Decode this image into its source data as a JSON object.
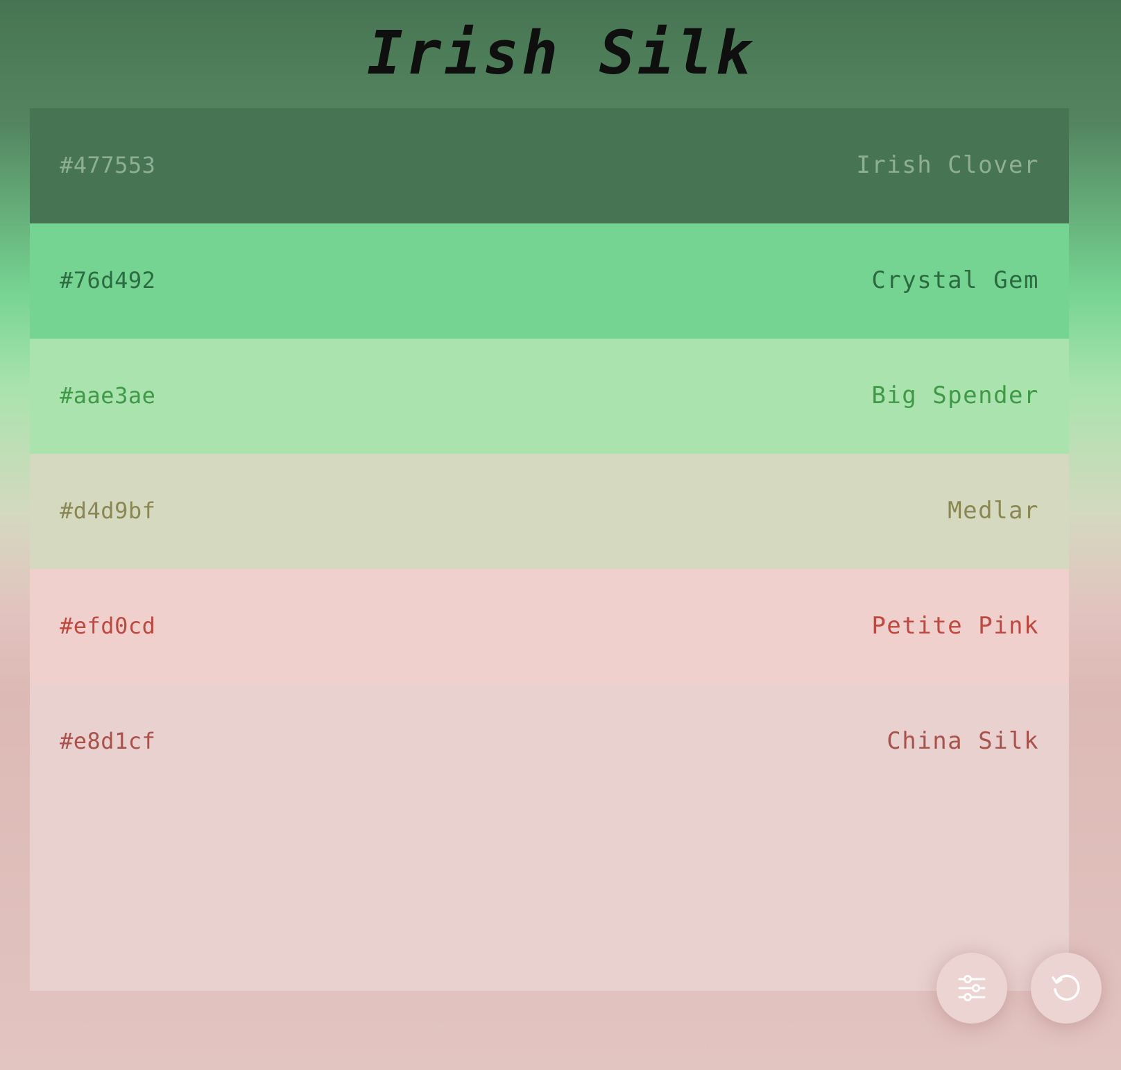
{
  "title": "Irish Silk",
  "swatches": [
    {
      "hex": "#477553",
      "name": "Irish Clover",
      "bg": "#477553",
      "text_color": "#8fae96"
    },
    {
      "hex": "#76d492",
      "name": "Crystal Gem",
      "bg": "#76d492",
      "text_color": "#2c6b41"
    },
    {
      "hex": "#aae3ae",
      "name": "Big Spender",
      "bg": "#aae3ae",
      "text_color": "#3e9a46"
    },
    {
      "hex": "#d4d9bf",
      "name": "Medlar",
      "bg": "#d4d9bf",
      "text_color": "#8a8752"
    },
    {
      "hex": "#efd0cd",
      "name": "Petite Pink",
      "bg": "#efd0cd",
      "text_color": "#c0483f"
    },
    {
      "hex": "#e8d1cf",
      "name": "China Silk",
      "bg": "#e8d1cf",
      "text_color": "#a9514a"
    }
  ],
  "controls": {
    "settings_icon": "sliders-icon",
    "refresh_icon": "refresh-icon",
    "icon_color": "#ffffff"
  }
}
